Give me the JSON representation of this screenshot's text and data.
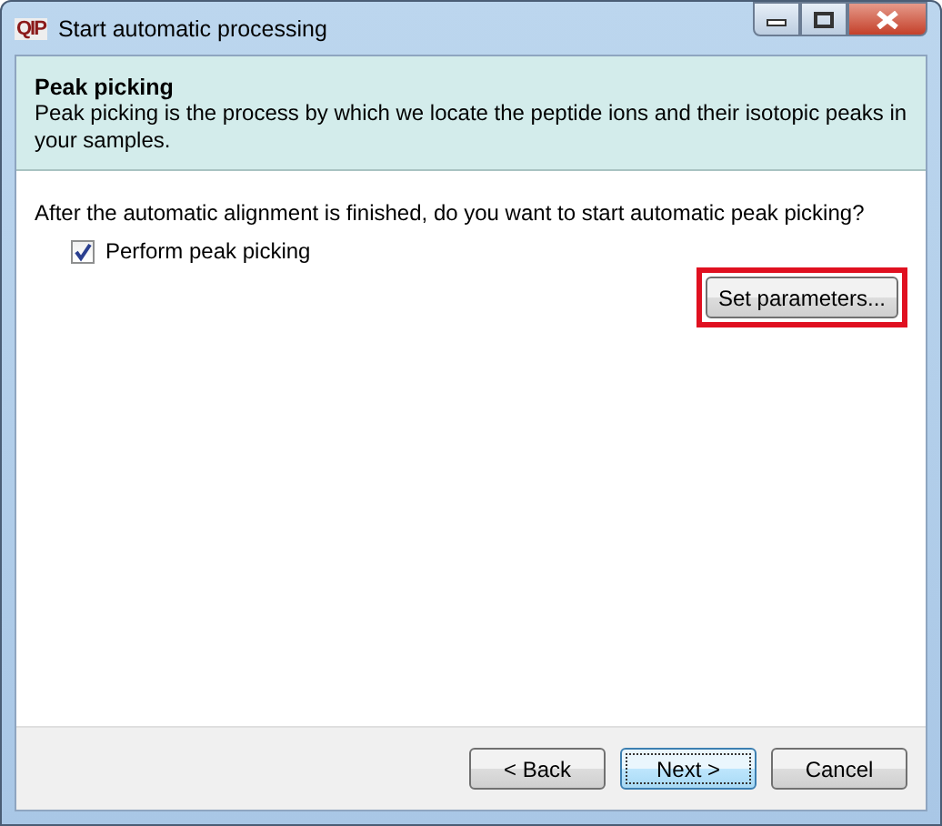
{
  "window": {
    "title": "Start automatic processing",
    "logo": "QIP"
  },
  "header": {
    "title": "Peak picking",
    "description": "Peak picking is the process by which we locate the peptide ions and their isotopic peaks in your samples."
  },
  "question": "After the automatic alignment is finished, do you want to start automatic peak picking?",
  "option": {
    "label": "Perform peak picking",
    "checked": true
  },
  "settings_button": {
    "label": "Set parameters...",
    "highlighted": true
  },
  "buttons": [
    {
      "label": "< Back",
      "focused": false
    },
    {
      "label": "Next >",
      "focused": true
    },
    {
      "label": "Cancel",
      "focused": false
    }
  ]
}
